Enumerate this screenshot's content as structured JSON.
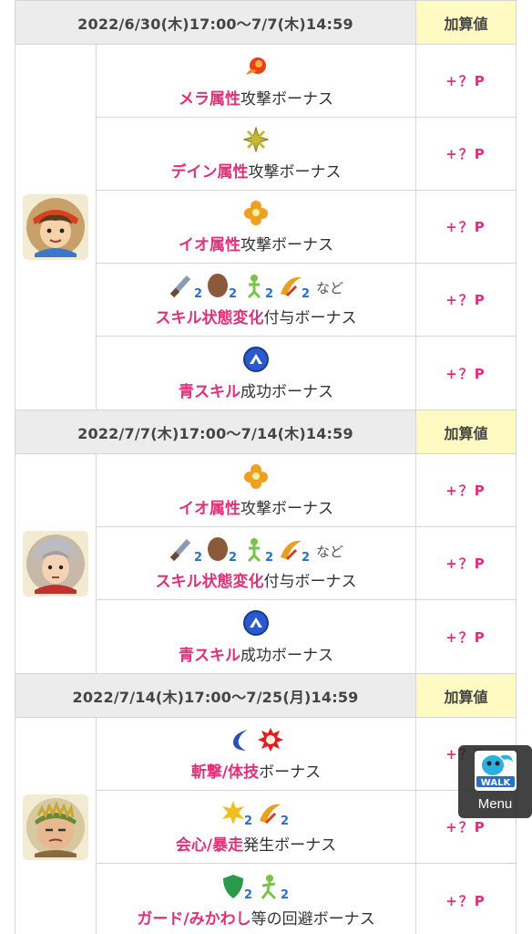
{
  "colors": {
    "accent": "#e0307a",
    "header_bg": "#ececec",
    "add_bg": "#fff9c2"
  },
  "sections": [
    {
      "date": "2022/6/30(木)17:00〜7/7(木)14:59",
      "add_label": "加算値",
      "avatar": "hero-avatar",
      "rows": [
        {
          "icons": [
            "fire-icon"
          ],
          "suffix_icons": "",
          "hl": "メラ属性",
          "rest": "攻撃ボーナス",
          "points": "+？P"
        },
        {
          "icons": [
            "lightning-icon"
          ],
          "suffix_icons": "",
          "hl": "デイン属性",
          "rest": "攻撃ボーナス",
          "points": "+？P"
        },
        {
          "icons": [
            "explosion-icon"
          ],
          "suffix_icons": "",
          "hl": "イオ属性",
          "rest": "攻撃ボーナス",
          "points": "+？P"
        },
        {
          "icons": [
            "attack-up-icon",
            "defense-up-icon",
            "speed-up-icon",
            "critical-up-icon"
          ],
          "suffix_icons": "など",
          "hl": "スキル状態変化",
          "rest": "付与ボーナス",
          "points": "+？P"
        },
        {
          "icons": [
            "blue-skill-icon"
          ],
          "suffix_icons": "",
          "hl": "青スキル",
          "rest": "成功ボーナス",
          "points": "+？P"
        }
      ]
    },
    {
      "date": "2022/7/7(木)17:00〜7/14(木)14:59",
      "add_label": "加算値",
      "avatar": "silver-hair-avatar",
      "rows": [
        {
          "icons": [
            "explosion-icon"
          ],
          "suffix_icons": "",
          "hl": "イオ属性",
          "rest": "攻撃ボーナス",
          "points": "+？P"
        },
        {
          "icons": [
            "attack-up-icon",
            "defense-up-icon",
            "speed-up-icon",
            "critical-up-icon"
          ],
          "suffix_icons": "など",
          "hl": "スキル状態変化",
          "rest": "付与ボーナス",
          "points": "+？P"
        },
        {
          "icons": [
            "blue-skill-icon"
          ],
          "suffix_icons": "",
          "hl": "青スキル",
          "rest": "成功ボーナス",
          "points": "+？P"
        }
      ]
    },
    {
      "date": "2022/7/14(木)17:00〜7/25(月)14:59",
      "add_label": "加算値",
      "avatar": "bandana-avatar",
      "rows": [
        {
          "icons": [
            "slash-icon",
            "martial-icon"
          ],
          "suffix_icons": "",
          "hl_parts": [
            "斬撃",
            "/",
            "体技"
          ],
          "hl": "斬撃/体技",
          "rest": "ボーナス",
          "points": "+？P"
        },
        {
          "icons": [
            "critical-up-icon",
            "berserk-up-icon"
          ],
          "suffix_icons": "",
          "hl": "会心/暴走",
          "rest": "発生ボーナス",
          "points": "+？P"
        },
        {
          "icons": [
            "guard-up-icon",
            "evasion-up-icon"
          ],
          "suffix_icons": "",
          "hl": "ガード/みかわし",
          "rest": "等の回避ボーナス",
          "points": "+？P"
        }
      ]
    }
  ],
  "menu": {
    "label": "Menu",
    "logo": "walk-logo-icon"
  }
}
